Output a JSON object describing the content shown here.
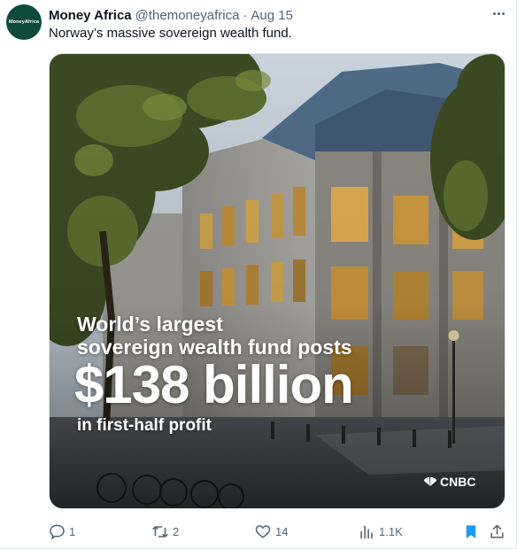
{
  "tweet": {
    "avatar_text": "MoneyAfrica",
    "display_name": "Money Africa",
    "handle": "@themoneyafrica",
    "separator": "·",
    "date": "Aug 15",
    "text": "Norway’s massive sovereign wealth fund."
  },
  "media": {
    "headline_line1": "World’s largest",
    "headline_line2": "sovereign wealth fund posts",
    "headline_big": "$138 billion",
    "headline_line4": "in first-half profit",
    "source_logo": "CNBC"
  },
  "actions": {
    "replies": "1",
    "retweets": "2",
    "likes": "14",
    "views": "1.1K"
  },
  "icons": {
    "more": "more-icon",
    "reply": "reply-icon",
    "retweet": "retweet-icon",
    "like": "heart-icon",
    "views": "views-icon",
    "bookmark": "bookmark-icon",
    "share": "share-icon"
  },
  "colors": {
    "avatar_bg": "#0d4a3b",
    "text_primary": "#0f1419",
    "text_secondary": "#536471",
    "bookmark_active": "#1d9bf0"
  }
}
